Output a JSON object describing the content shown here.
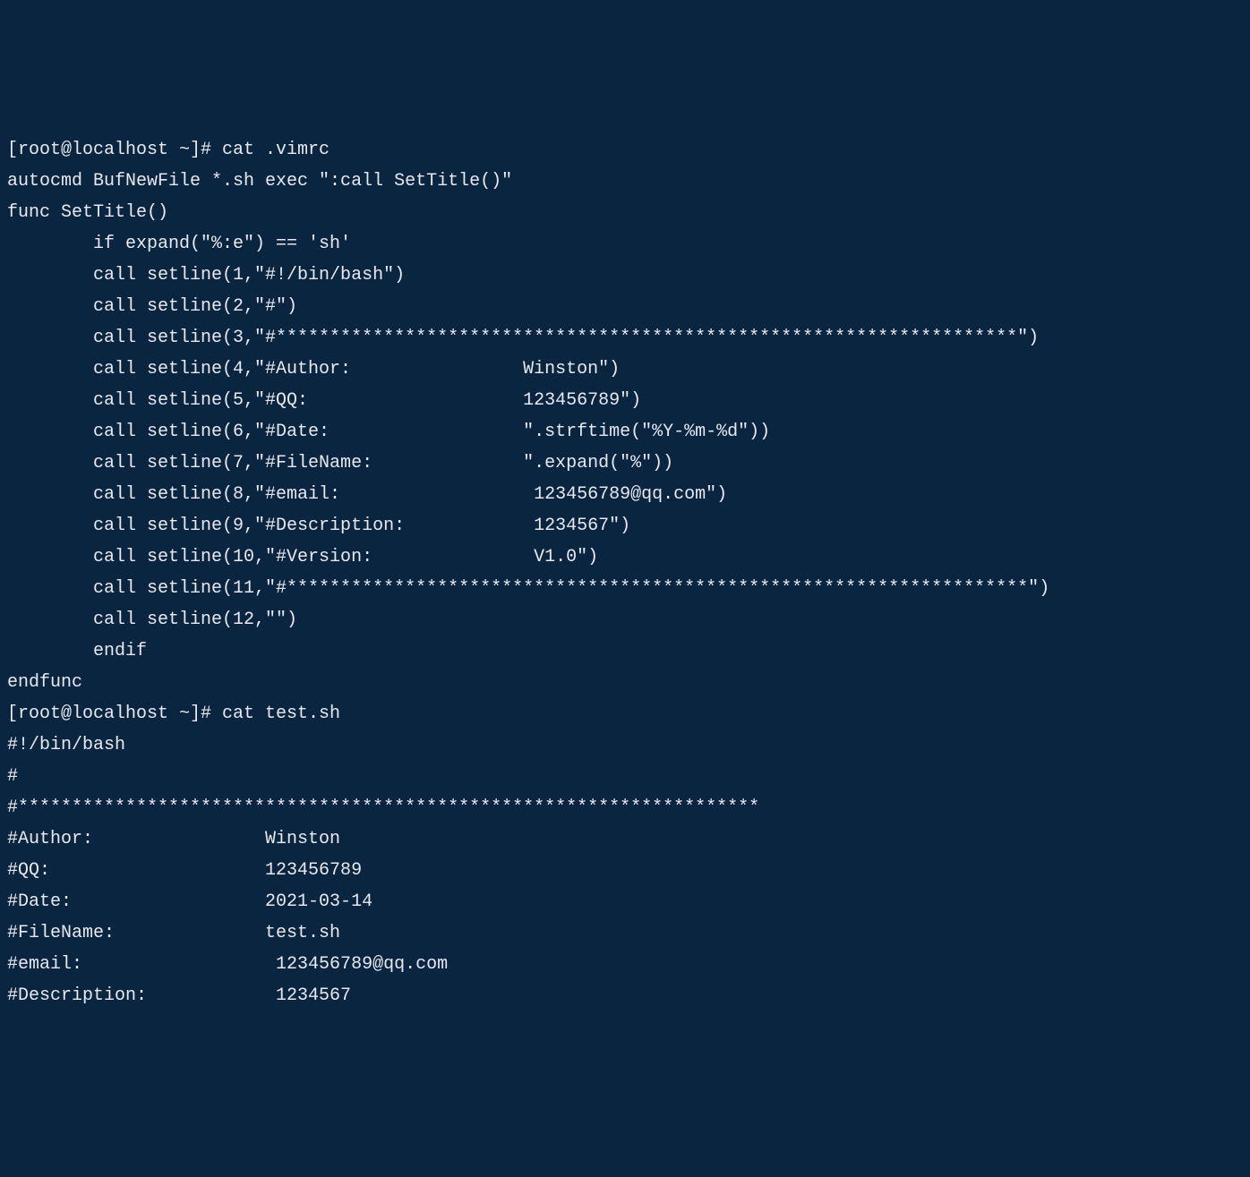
{
  "terminal": {
    "lines": [
      "[root@localhost ~]# cat .vimrc",
      "autocmd BufNewFile *.sh exec \":call SetTitle()\"",
      "func SetTitle()",
      "        if expand(\"%:e\") == 'sh'",
      "        call setline(1,\"#!/bin/bash\")",
      "        call setline(2,\"#\")",
      "        call setline(3,\"#*********************************************************************\")",
      "        call setline(4,\"#Author:                Winston\")",
      "        call setline(5,\"#QQ:                    123456789\")",
      "        call setline(6,\"#Date:                  \".strftime(\"%Y-%m-%d\"))",
      "        call setline(7,\"#FileName:              \".expand(\"%\"))",
      "        call setline(8,\"#email:                  123456789@qq.com\")",
      "        call setline(9,\"#Description:            1234567\")",
      "        call setline(10,\"#Version:               V1.0\")",
      "        call setline(11,\"#*********************************************************************\")",
      "        call setline(12,\"\")",
      "        endif",
      "endfunc",
      "[root@localhost ~]# cat test.sh",
      "#!/bin/bash",
      "#",
      "#*********************************************************************",
      "#Author:                Winston",
      "#QQ:                    123456789",
      "#Date:                  2021-03-14",
      "#FileName:              test.sh",
      "#email:                  123456789@qq.com",
      "#Description:            1234567"
    ]
  }
}
